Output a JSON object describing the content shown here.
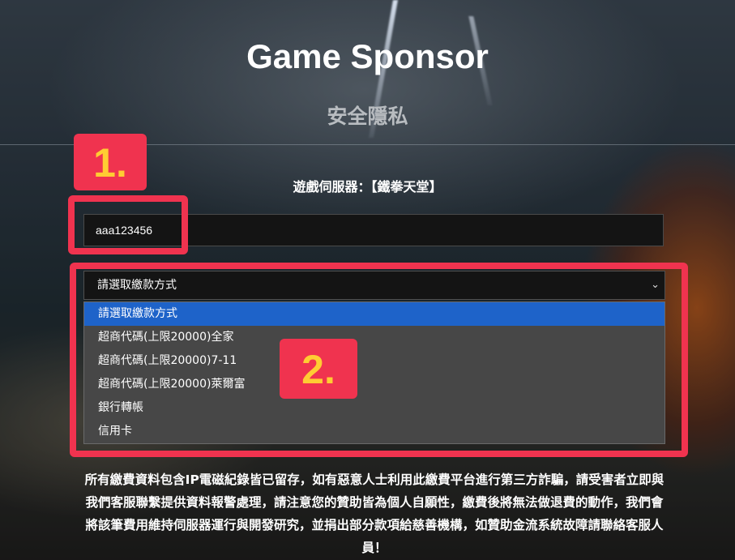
{
  "header": {
    "title": "Game Sponsor",
    "subtitle": "安全隱私"
  },
  "server": {
    "label": "遊戲伺服器：【鐵拳天堂】"
  },
  "account": {
    "value": "aaa123456"
  },
  "payment": {
    "selected": "請選取繳款方式",
    "options": [
      "請選取繳款方式",
      "超商代碼(上限20000)全家",
      "超商代碼(上限20000)7-11",
      "超商代碼(上限20000)萊爾富",
      "銀行轉帳",
      "信用卡"
    ]
  },
  "annotations": {
    "step1": "1.",
    "step2": "2."
  },
  "notice": "所有繳費資料包含IP電磁紀錄皆已留存，如有惡意人士利用此繳費平台進行第三方詐騙，請受害者立即與我們客服聯繫提供資料報警處理，請注意您的贊助皆為個人自願性，繳費後將無法做退費的動作，我們會將該筆費用維持伺服器運行與開發研究，並捐出部分款項給慈善機構，如贊助金流系統故障請聯絡客服人員！",
  "colors": {
    "annotation_red": "#f0334f",
    "annotation_number": "#ffcc33",
    "selected_option": "#1e63c9"
  }
}
